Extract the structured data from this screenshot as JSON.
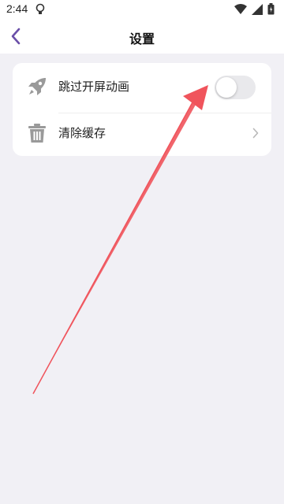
{
  "status_bar": {
    "time": "2:44",
    "icons": [
      "lightbulb-icon",
      "wifi-icon",
      "signal-icon",
      "battery-icon"
    ]
  },
  "header": {
    "title": "设置",
    "back_icon": "chevron-left-icon"
  },
  "settings": {
    "items": [
      {
        "icon": "rocket-icon",
        "label": "跳过开屏动画",
        "control": "toggle",
        "toggle_on": false
      },
      {
        "icon": "trash-icon",
        "label": "清除缓存",
        "control": "chevron-right-icon"
      }
    ]
  },
  "colors": {
    "background": "#f1f0f5",
    "card": "#ffffff",
    "accent": "#6a4fa8",
    "annotation_arrow": "#f0545c"
  }
}
